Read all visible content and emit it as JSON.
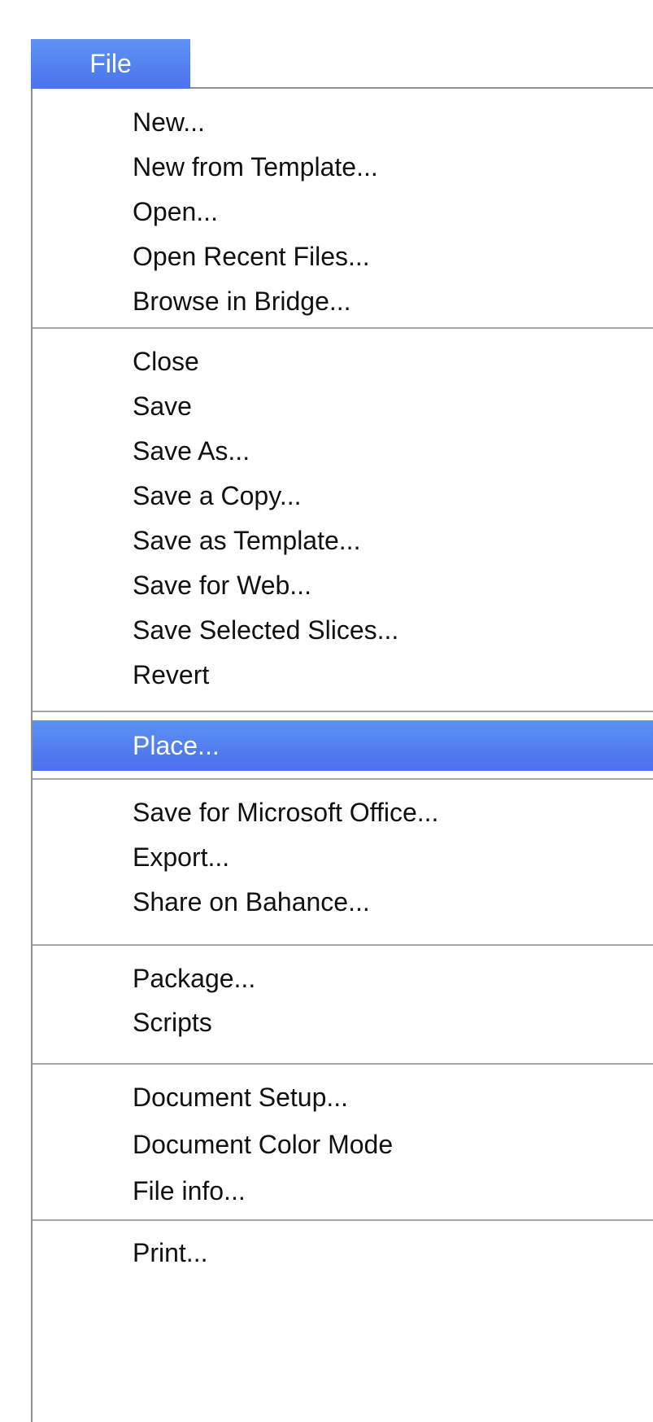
{
  "menu": {
    "title": "File",
    "items": [
      {
        "label": "New..."
      },
      {
        "label": "New from Template..."
      },
      {
        "label": "Open..."
      },
      {
        "label": "Open Recent Files..."
      },
      {
        "label": "Browse in Bridge..."
      },
      {
        "label": "Close"
      },
      {
        "label": "Save"
      },
      {
        "label": "Save As..."
      },
      {
        "label": "Save a Copy..."
      },
      {
        "label": "Save as Template..."
      },
      {
        "label": "Save for Web..."
      },
      {
        "label": "Save Selected Slices..."
      },
      {
        "label": "Revert"
      },
      {
        "label": "Place...",
        "selected": true
      },
      {
        "label": "Save for Microsoft Office..."
      },
      {
        "label": "Export..."
      },
      {
        "label": "Share on Bahance..."
      },
      {
        "label": "Package..."
      },
      {
        "label": "Scripts"
      },
      {
        "label": "Document Setup..."
      },
      {
        "label": "Document Color Mode"
      },
      {
        "label": "File info..."
      },
      {
        "label": "Print..."
      }
    ]
  },
  "colors": {
    "highlight": "#4f7ef0",
    "separator": "#a6a6a6",
    "border": "#8f8f8f"
  }
}
